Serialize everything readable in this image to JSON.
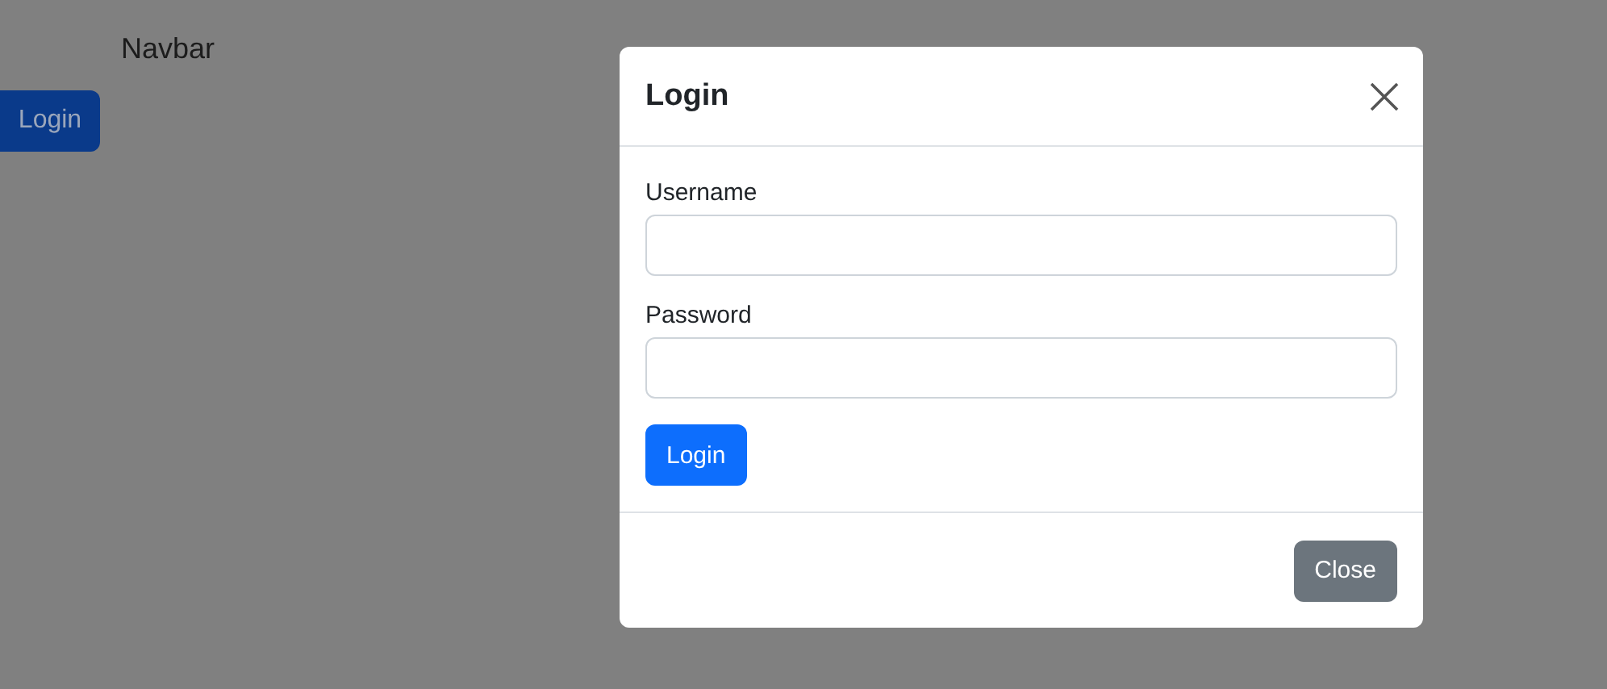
{
  "navbar": {
    "brand": "Navbar",
    "button": "Login"
  },
  "modal": {
    "title": "Login",
    "fields": [
      {
        "label": "Username"
      },
      {
        "label": "Password"
      }
    ],
    "submit": "Login",
    "footer_button": "Close"
  }
}
